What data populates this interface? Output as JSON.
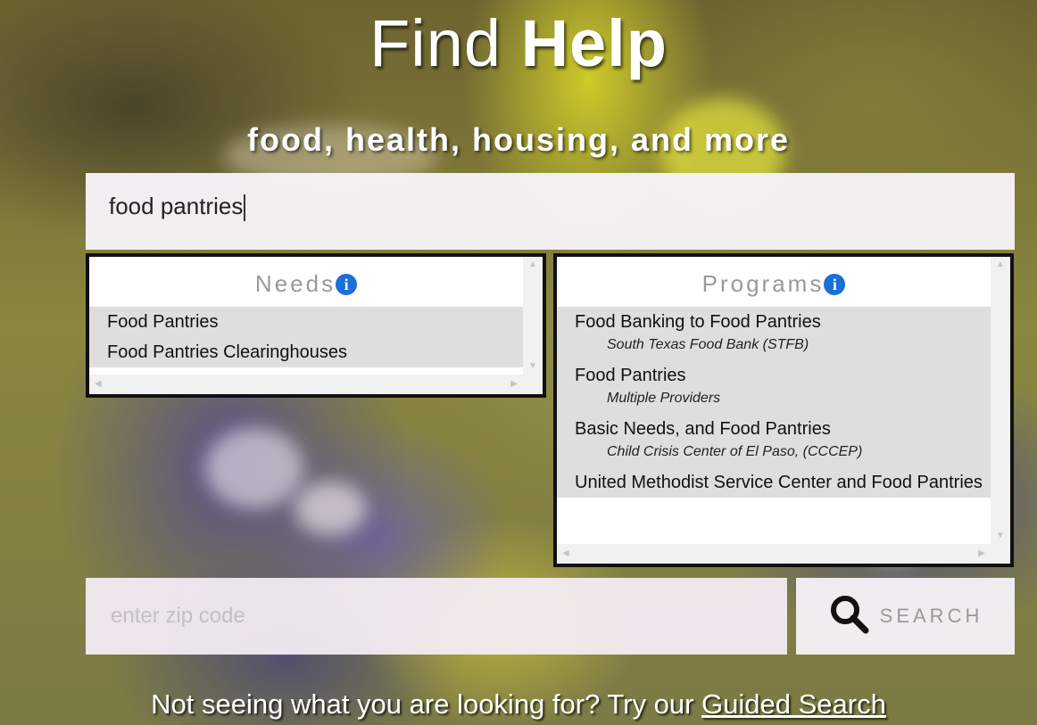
{
  "header": {
    "title_part1": "Find",
    "title_part2": "Help",
    "subtitle": "food, health, housing, and more"
  },
  "search": {
    "query": "food pantries"
  },
  "needs_panel": {
    "heading": "Needs",
    "items": [
      "Food Pantries",
      "Food Pantries Clearinghouses"
    ]
  },
  "programs_panel": {
    "heading": "Programs",
    "items": [
      {
        "name": "Food Banking to Food Pantries",
        "provider": "South Texas Food Bank (STFB)"
      },
      {
        "name": "Food Pantries",
        "provider": "Multiple Providers"
      },
      {
        "name": "Basic Needs, and Food Pantries",
        "provider": "Child Crisis Center of El Paso, (CCCEP)"
      },
      {
        "name": "United Methodist Service Center and Food Pantries",
        "provider": ""
      }
    ]
  },
  "zip": {
    "placeholder": "enter zip code"
  },
  "search_button": {
    "label": "SEARCH",
    "icon": "search-icon"
  },
  "footer": {
    "text": "Not seeing what you are looking for? Try our",
    "link": "Guided Search"
  },
  "colors": {
    "info_icon": "#1a6fd8",
    "panel_border": "#111111",
    "list_bg": "#dedede"
  }
}
